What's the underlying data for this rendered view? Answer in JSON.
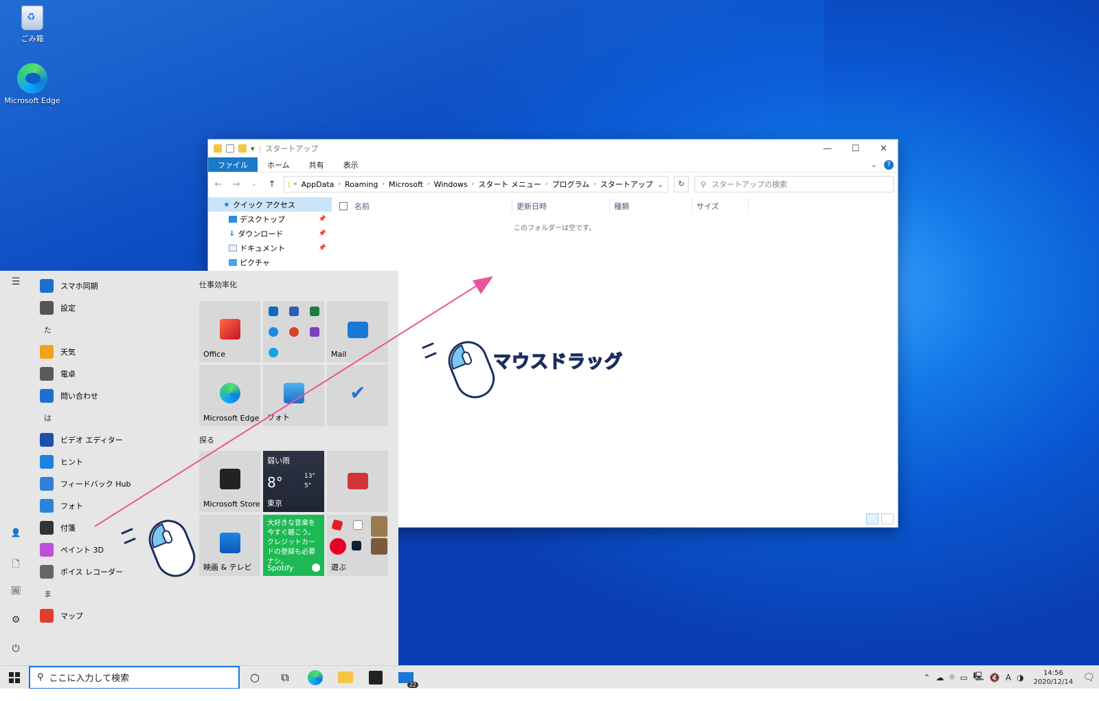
{
  "desktop": {
    "icons": [
      {
        "label": "ごみ箱",
        "icon": "recycle-bin-icon"
      },
      {
        "label": "Microsoft Edge",
        "icon": "edge-icon"
      }
    ]
  },
  "explorer": {
    "title": "スタートアップ",
    "window_buttons": [
      "—",
      "☐",
      "✕"
    ],
    "ribbon_tabs": [
      "ファイル",
      "ホーム",
      "共有",
      "表示"
    ],
    "address_crumbs": [
      "AppData",
      "Roaming",
      "Microsoft",
      "Windows",
      "スタート メニュー",
      "プログラム",
      "スタートアップ"
    ],
    "search_placeholder": "スタートアップの検索",
    "nav_items": [
      {
        "label": "クイック アクセス"
      },
      {
        "label": "デスクトップ"
      },
      {
        "label": "ダウンロード"
      },
      {
        "label": "ドキュメント"
      },
      {
        "label": "ピクチャ"
      }
    ],
    "columns": [
      "名前",
      "更新日時",
      "種類",
      "サイズ"
    ],
    "empty_message": "このフォルダーは空です。"
  },
  "start_menu": {
    "apps": [
      {
        "type": "app",
        "label": "スマホ同期",
        "color": "#1f6fd1"
      },
      {
        "type": "app",
        "label": "設定",
        "color": "#555555"
      },
      {
        "type": "letter",
        "label": "た"
      },
      {
        "type": "app",
        "label": "天気",
        "color": "#f3a21b"
      },
      {
        "type": "app",
        "label": "電卓",
        "color": "#5a5a5a"
      },
      {
        "type": "app",
        "label": "問い合わせ",
        "color": "#1f6fd1"
      },
      {
        "type": "letter",
        "label": "は"
      },
      {
        "type": "app",
        "label": "ビデオ エディター",
        "color": "#1d4fa8"
      },
      {
        "type": "app",
        "label": "ヒント",
        "color": "#1f82e0"
      },
      {
        "type": "app",
        "label": "フィードバック Hub",
        "color": "#2f7fdc"
      },
      {
        "type": "app",
        "label": "フォト",
        "color": "#2b84d8"
      },
      {
        "type": "app",
        "label": "付箋",
        "color": "#333333"
      },
      {
        "type": "app",
        "label": "ペイント 3D",
        "color": "#c04fd8"
      },
      {
        "type": "app",
        "label": "ボイス レコーダー",
        "color": "#666666"
      },
      {
        "type": "letter",
        "label": "ま"
      },
      {
        "type": "app",
        "label": "マップ",
        "color": "#e23b2f"
      }
    ],
    "groups": [
      "仕事効率化",
      "探る"
    ],
    "tiles": {
      "office": "Office",
      "mail": "Mail",
      "edge": "Microsoft Edge",
      "photos": "フォト",
      "store": "Microsoft Store",
      "weather_condition": "弱い雨",
      "weather_temp": "8°",
      "weather_high": "13°",
      "weather_low": "5°",
      "weather_city": "東京",
      "movies": "映画 & テレビ",
      "spotify_text": "大好きな音楽を今すぐ聴こう。クレジットカードの登録も必要ナシ。",
      "spotify": "Spotify",
      "play": "遊ぶ"
    }
  },
  "taskbar": {
    "search_placeholder": "ここに入力して検索",
    "mail_badge": "22",
    "ime": "A",
    "time": "14:56",
    "date": "2020/12/14"
  },
  "annotation": {
    "label": "マウスドラッグ",
    "arrow_color": "#e8559b"
  }
}
